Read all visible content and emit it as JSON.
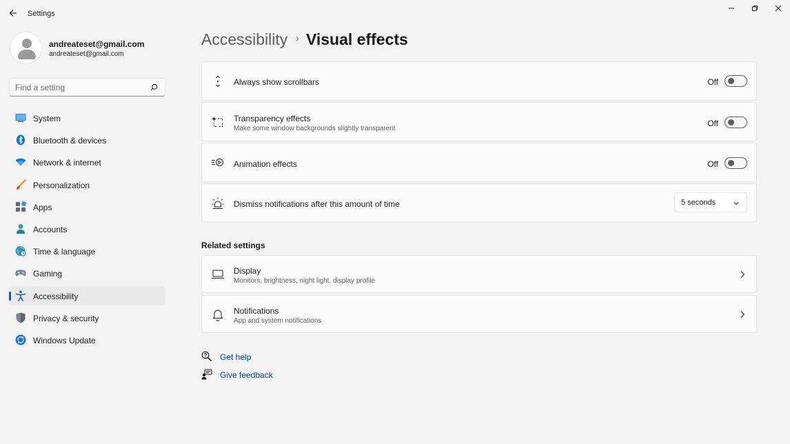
{
  "window": {
    "app_title": "Settings"
  },
  "profile": {
    "name": "andreateset@gmail.com",
    "email": "andreateset@gmail.com"
  },
  "search": {
    "placeholder": "Find a setting"
  },
  "sidebar": {
    "items": [
      {
        "label": "System",
        "icon": "system-icon"
      },
      {
        "label": "Bluetooth & devices",
        "icon": "bluetooth-icon"
      },
      {
        "label": "Network & internet",
        "icon": "wifi-icon"
      },
      {
        "label": "Personalization",
        "icon": "brush-icon"
      },
      {
        "label": "Apps",
        "icon": "apps-icon"
      },
      {
        "label": "Accounts",
        "icon": "person-icon"
      },
      {
        "label": "Time & language",
        "icon": "globe-clock-icon"
      },
      {
        "label": "Gaming",
        "icon": "gamepad-icon"
      },
      {
        "label": "Accessibility",
        "icon": "accessibility-icon",
        "active": true
      },
      {
        "label": "Privacy & security",
        "icon": "shield-icon"
      },
      {
        "label": "Windows Update",
        "icon": "update-icon"
      }
    ]
  },
  "breadcrumb": {
    "parent": "Accessibility",
    "separator": "›",
    "current": "Visual effects"
  },
  "settings": [
    {
      "title": "Always show scrollbars",
      "subtitle": "",
      "control": "toggle",
      "state_label": "Off",
      "on": false,
      "icon": "scrollbar-icon"
    },
    {
      "title": "Transparency effects",
      "subtitle": "Make some window backgrounds slightly transparent",
      "control": "toggle",
      "state_label": "Off",
      "on": false,
      "icon": "transparency-icon"
    },
    {
      "title": "Animation effects",
      "subtitle": "",
      "control": "toggle",
      "state_label": "Off",
      "on": false,
      "icon": "animation-icon"
    },
    {
      "title": "Dismiss notifications after this amount of time",
      "subtitle": "",
      "control": "dropdown",
      "value": "5 seconds",
      "icon": "notification-timer-icon"
    }
  ],
  "related": {
    "heading": "Related settings",
    "items": [
      {
        "title": "Display",
        "subtitle": "Monitors, brightness, night light, display profile",
        "icon": "monitor-icon"
      },
      {
        "title": "Notifications",
        "subtitle": "App and system notifications",
        "icon": "bell-icon"
      }
    ]
  },
  "help": {
    "get_help": "Get help",
    "give_feedback": "Give feedback"
  },
  "colors": {
    "accent": "#005fb8",
    "link": "#003e92",
    "background": "#f3f3f3",
    "card": "#fbfbfb"
  }
}
